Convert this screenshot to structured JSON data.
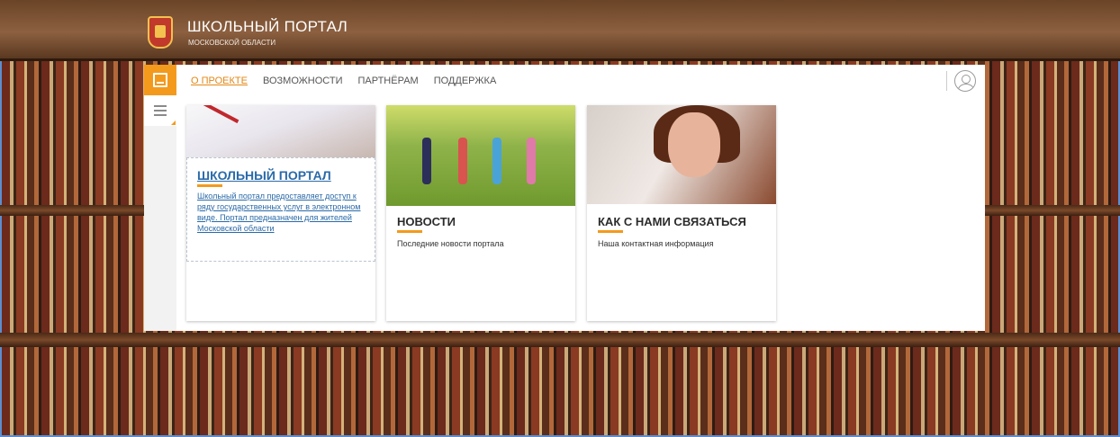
{
  "header": {
    "title": "ШКОЛЬНЫЙ ПОРТАЛ",
    "subtitle": "МОСКОВСКОЙ ОБЛАСТИ"
  },
  "nav": {
    "items": [
      {
        "label": "О ПРОЕКТЕ",
        "active": true
      },
      {
        "label": "ВОЗМОЖНОСТИ",
        "active": false
      },
      {
        "label": "ПАРТНЁРАМ",
        "active": false
      },
      {
        "label": "ПОДДЕРЖКА",
        "active": false
      }
    ]
  },
  "cards": [
    {
      "title": "ШКОЛЬНЫЙ ПОРТАЛ",
      "description": "Школьный портал предоставляет доступ к ряду государственных услуг в электронном виде. Портал предназначен для жителей Московской области"
    },
    {
      "title": "НОВОСТИ",
      "description": "Последние новости портала"
    },
    {
      "title": "КАК С НАМИ СВЯЗАТЬСЯ",
      "description": "Наша контактная информация"
    }
  ],
  "icons": {
    "emblem": "moscow-oblast-emblem-icon",
    "book": "book-icon",
    "menu": "hamburger-menu-icon",
    "user": "user-account-icon"
  },
  "colors": {
    "accent": "#f39a1d",
    "link": "#2a6aa8",
    "nav_active": "#e38714"
  }
}
